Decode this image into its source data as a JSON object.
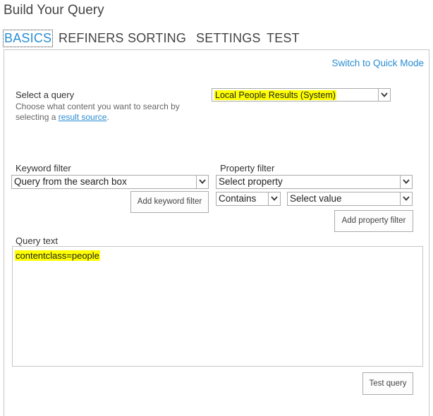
{
  "title": "Build Your Query",
  "tabs": [
    {
      "label": "BASICS",
      "active": true
    },
    {
      "label": "REFINERS"
    },
    {
      "label": "SORTING"
    },
    {
      "label": "SETTINGS"
    },
    {
      "label": "TEST"
    }
  ],
  "quick_mode_link": "Switch to Quick Mode",
  "select_query": {
    "label": "Select a query",
    "hint_prefix": "Choose what content you want to search by selecting a ",
    "hint_link": "result source",
    "hint_suffix": ".",
    "value": "Local People Results (System)"
  },
  "keyword_filter": {
    "label": "Keyword filter",
    "value": "Query from the search box",
    "add_button": "Add keyword filter"
  },
  "property_filter": {
    "label": "Property filter",
    "property_value": "Select property",
    "operator_value": "Contains",
    "value_value": "Select value",
    "add_button": "Add property filter"
  },
  "query_text": {
    "label": "Query text",
    "value": "contentclass=people"
  },
  "test_button": "Test query",
  "colors": {
    "accent": "#2a8dd4",
    "highlight": "#ffff00"
  },
  "icons": {
    "dropdown": "chevron-down-icon"
  }
}
